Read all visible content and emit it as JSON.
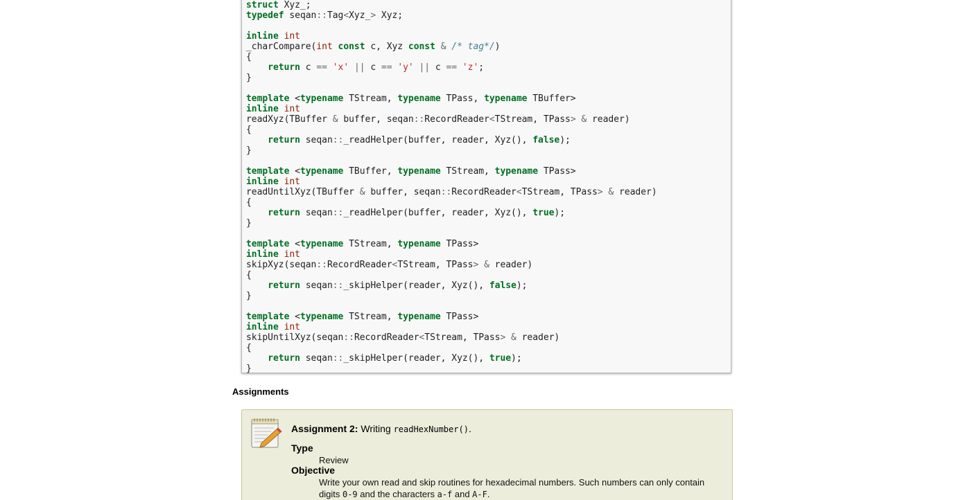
{
  "code": {
    "lines": [
      [
        [
          "k",
          "struct"
        ],
        [
          "n",
          " Xyz_;"
        ]
      ],
      [
        [
          "k",
          "typedef"
        ],
        [
          "n",
          " seqan"
        ],
        [
          "o",
          "::"
        ],
        [
          "n",
          "Tag"
        ],
        [
          "o",
          "<"
        ],
        [
          "n",
          "Xyz_"
        ],
        [
          "o",
          ">"
        ],
        [
          "n",
          " Xyz;"
        ]
      ],
      [],
      [
        [
          "k",
          "inline"
        ],
        [
          "n",
          " "
        ],
        [
          "t",
          "int"
        ]
      ],
      [
        [
          "n",
          "_charCompare("
        ],
        [
          "t",
          "int"
        ],
        [
          "n",
          " "
        ],
        [
          "k",
          "const"
        ],
        [
          "n",
          " c, Xyz "
        ],
        [
          "k",
          "const"
        ],
        [
          "n",
          " "
        ],
        [
          "o",
          "&"
        ],
        [
          "n",
          " "
        ],
        [
          "c",
          "/* tag*/"
        ],
        [
          "n",
          ")"
        ]
      ],
      [
        [
          "n",
          "{"
        ]
      ],
      [
        [
          "n",
          "    "
        ],
        [
          "k",
          "return"
        ],
        [
          "n",
          " c "
        ],
        [
          "o",
          "=="
        ],
        [
          "n",
          " "
        ],
        [
          "s",
          "'x'"
        ],
        [
          "n",
          " "
        ],
        [
          "o",
          "||"
        ],
        [
          "n",
          " c "
        ],
        [
          "o",
          "=="
        ],
        [
          "n",
          " "
        ],
        [
          "s",
          "'y'"
        ],
        [
          "n",
          " "
        ],
        [
          "o",
          "||"
        ],
        [
          "n",
          " c "
        ],
        [
          "o",
          "=="
        ],
        [
          "n",
          " "
        ],
        [
          "s",
          "'z'"
        ],
        [
          "n",
          ";"
        ]
      ],
      [
        [
          "n",
          "}"
        ]
      ],
      [],
      [
        [
          "k",
          "template"
        ],
        [
          "n",
          " <"
        ],
        [
          "k",
          "typename"
        ],
        [
          "n",
          " TStream, "
        ],
        [
          "k",
          "typename"
        ],
        [
          "n",
          " TPass, "
        ],
        [
          "k",
          "typename"
        ],
        [
          "n",
          " TBuffer>"
        ]
      ],
      [
        [
          "k",
          "inline"
        ],
        [
          "n",
          " "
        ],
        [
          "t",
          "int"
        ]
      ],
      [
        [
          "n",
          "readXyz(TBuffer "
        ],
        [
          "o",
          "&"
        ],
        [
          "n",
          " buffer, seqan"
        ],
        [
          "o",
          "::"
        ],
        [
          "n",
          "RecordReader"
        ],
        [
          "o",
          "<"
        ],
        [
          "n",
          "TStream, TPass"
        ],
        [
          "o",
          ">"
        ],
        [
          "n",
          " "
        ],
        [
          "o",
          "&"
        ],
        [
          "n",
          " reader)"
        ]
      ],
      [
        [
          "n",
          "{"
        ]
      ],
      [
        [
          "n",
          "    "
        ],
        [
          "k",
          "return"
        ],
        [
          "n",
          " seqan"
        ],
        [
          "o",
          "::"
        ],
        [
          "n",
          "_readHelper(buffer, reader, Xyz(), "
        ],
        [
          "k",
          "false"
        ],
        [
          "n",
          ");"
        ]
      ],
      [
        [
          "n",
          "}"
        ]
      ],
      [],
      [
        [
          "k",
          "template"
        ],
        [
          "n",
          " <"
        ],
        [
          "k",
          "typename"
        ],
        [
          "n",
          " TBuffer, "
        ],
        [
          "k",
          "typename"
        ],
        [
          "n",
          " TStream, "
        ],
        [
          "k",
          "typename"
        ],
        [
          "n",
          " TPass>"
        ]
      ],
      [
        [
          "k",
          "inline"
        ],
        [
          "n",
          " "
        ],
        [
          "t",
          "int"
        ]
      ],
      [
        [
          "n",
          "readUntilXyz(TBuffer "
        ],
        [
          "o",
          "&"
        ],
        [
          "n",
          " buffer, seqan"
        ],
        [
          "o",
          "::"
        ],
        [
          "n",
          "RecordReader"
        ],
        [
          "o",
          "<"
        ],
        [
          "n",
          "TStream, TPass"
        ],
        [
          "o",
          ">"
        ],
        [
          "n",
          " "
        ],
        [
          "o",
          "&"
        ],
        [
          "n",
          " reader)"
        ]
      ],
      [
        [
          "n",
          "{"
        ]
      ],
      [
        [
          "n",
          "    "
        ],
        [
          "k",
          "return"
        ],
        [
          "n",
          " seqan"
        ],
        [
          "o",
          "::"
        ],
        [
          "n",
          "_readHelper(buffer, reader, Xyz(), "
        ],
        [
          "k",
          "true"
        ],
        [
          "n",
          ");"
        ]
      ],
      [
        [
          "n",
          "}"
        ]
      ],
      [],
      [
        [
          "k",
          "template"
        ],
        [
          "n",
          " <"
        ],
        [
          "k",
          "typename"
        ],
        [
          "n",
          " TStream, "
        ],
        [
          "k",
          "typename"
        ],
        [
          "n",
          " TPass>"
        ]
      ],
      [
        [
          "k",
          "inline"
        ],
        [
          "n",
          " "
        ],
        [
          "t",
          "int"
        ]
      ],
      [
        [
          "n",
          "skipXyz(seqan"
        ],
        [
          "o",
          "::"
        ],
        [
          "n",
          "RecordReader"
        ],
        [
          "o",
          "<"
        ],
        [
          "n",
          "TStream, TPass"
        ],
        [
          "o",
          ">"
        ],
        [
          "n",
          " "
        ],
        [
          "o",
          "&"
        ],
        [
          "n",
          " reader)"
        ]
      ],
      [
        [
          "n",
          "{"
        ]
      ],
      [
        [
          "n",
          "    "
        ],
        [
          "k",
          "return"
        ],
        [
          "n",
          " seqan"
        ],
        [
          "o",
          "::"
        ],
        [
          "n",
          "_skipHelper(reader, Xyz(), "
        ],
        [
          "k",
          "false"
        ],
        [
          "n",
          ");"
        ]
      ],
      [
        [
          "n",
          "}"
        ]
      ],
      [],
      [
        [
          "k",
          "template"
        ],
        [
          "n",
          " <"
        ],
        [
          "k",
          "typename"
        ],
        [
          "n",
          " TStream, "
        ],
        [
          "k",
          "typename"
        ],
        [
          "n",
          " TPass>"
        ]
      ],
      [
        [
          "k",
          "inline"
        ],
        [
          "n",
          " "
        ],
        [
          "t",
          "int"
        ]
      ],
      [
        [
          "n",
          "skipUntilXyz(seqan"
        ],
        [
          "o",
          "::"
        ],
        [
          "n",
          "RecordReader"
        ],
        [
          "o",
          "<"
        ],
        [
          "n",
          "TStream, TPass"
        ],
        [
          "o",
          ">"
        ],
        [
          "n",
          " "
        ],
        [
          "o",
          "&"
        ],
        [
          "n",
          " reader)"
        ]
      ],
      [
        [
          "n",
          "{"
        ]
      ],
      [
        [
          "n",
          "    "
        ],
        [
          "k",
          "return"
        ],
        [
          "n",
          " seqan"
        ],
        [
          "o",
          "::"
        ],
        [
          "n",
          "_skipHelper(reader, Xyz(), "
        ],
        [
          "k",
          "true"
        ],
        [
          "n",
          ");"
        ]
      ],
      [
        [
          "n",
          "}"
        ]
      ]
    ]
  },
  "assignments": {
    "heading": "Assignments",
    "icon": "notepad-pencil-icon",
    "title_label": "Assignment 2:",
    "title_text": " Writing ",
    "title_code": "readHexNumber()",
    "title_end": ".",
    "type_label": "Type",
    "type_value": "Review",
    "objective_label": "Objective",
    "objective_1": "Write your own read and skip routines for hexadecimal numbers. Such numbers can only contain digits ",
    "objective_code1": "0-9",
    "objective_2": " and the characters ",
    "objective_code2": "a-f",
    "objective_3": " and ",
    "objective_code3": "A-F",
    "objective_4": "."
  }
}
